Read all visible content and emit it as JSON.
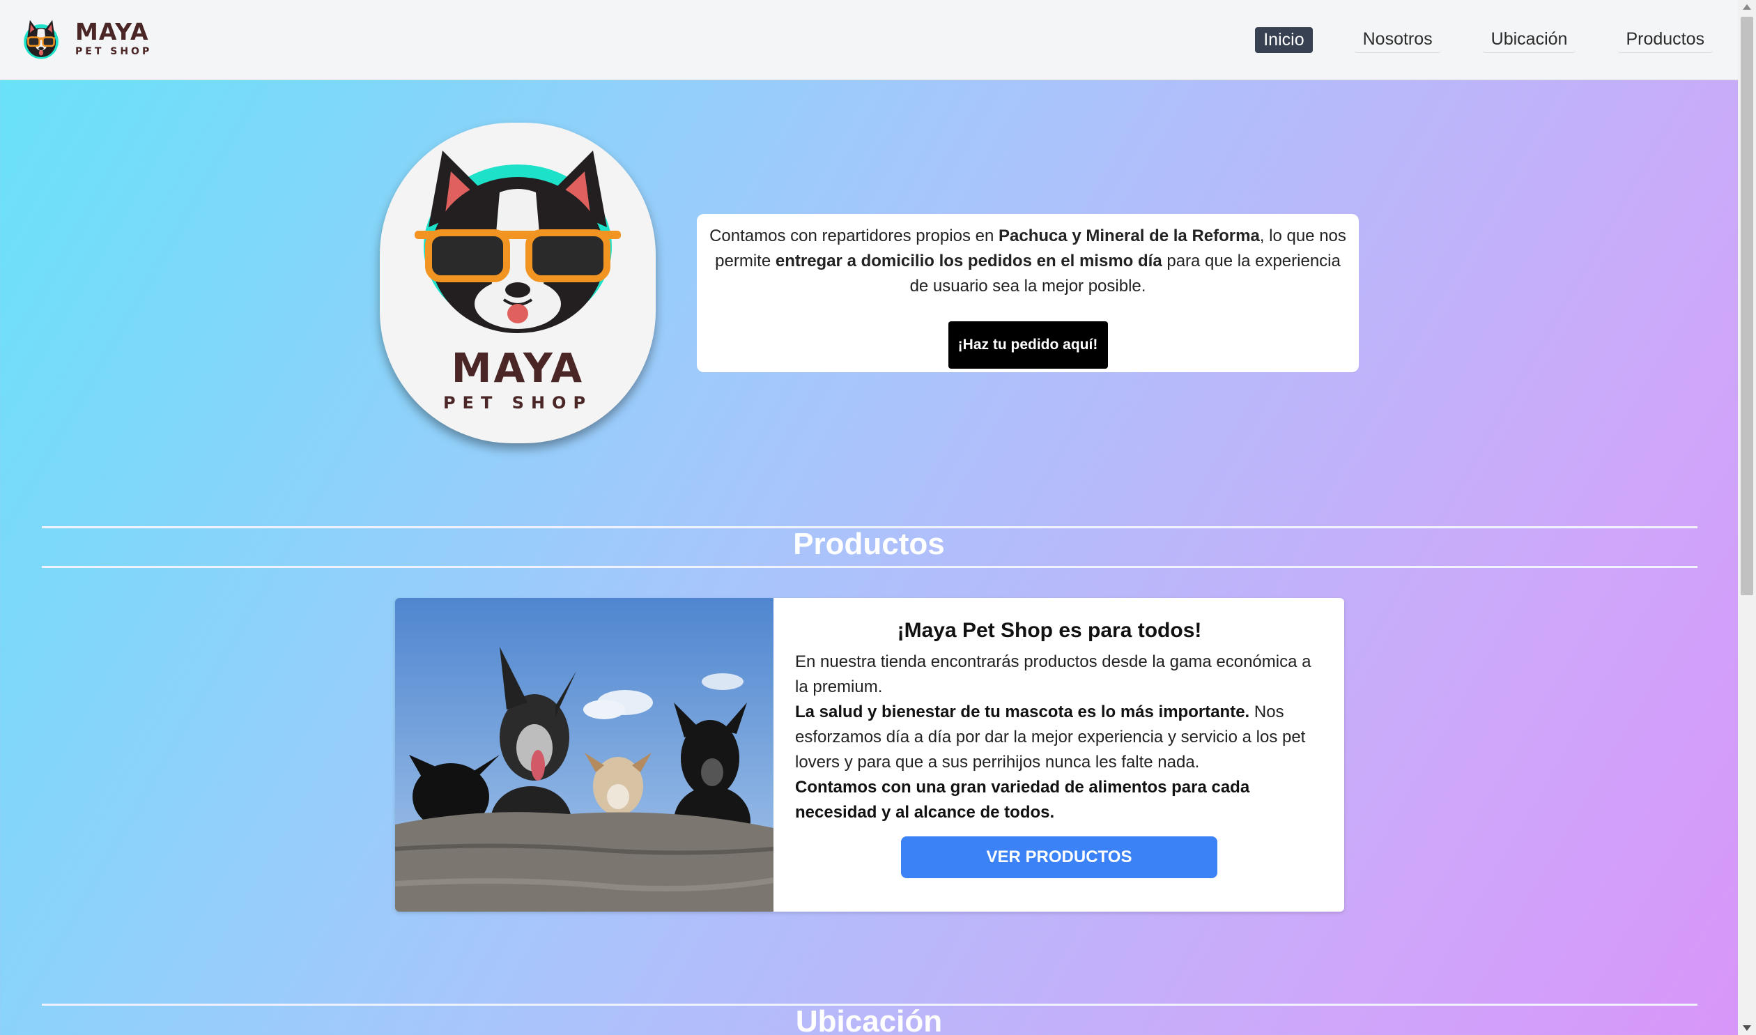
{
  "navbar": {
    "brand_title": "MAYA",
    "brand_subtitle": "PET SHOP",
    "links": [
      "Inicio",
      "Nosotros",
      "Ubicación",
      "Productos"
    ],
    "active_link": "Inicio"
  },
  "hero": {
    "logo_title": "MAYA",
    "logo_subtitle": "PET SHOP",
    "delivery_text_1": "Contamos con repartidores propios en ",
    "delivery_bold_1": "Pachuca y Mineral de la Reforma",
    "delivery_text_2": ", lo que nos permite ",
    "delivery_bold_2": "entregar a domicilio los pedidos en el mismo día",
    "delivery_text_3": " para que la experiencia de usuario sea la mejor posible.",
    "order_button": "¡Haz tu pedido aquí!"
  },
  "products_section": {
    "title": "Productos",
    "card_title": "¡Maya Pet Shop es para todos!",
    "text_1": "En nuestra tienda encontrarás productos desde la gama económica a la premium.",
    "bold_1": "La salud y bienestar de tu mascota es lo más importante.",
    "text_2": " Nos esforzamos día a día por dar la mejor experiencia y servicio a los pet lovers y para que a sus perrihijos nunca les falte nada.",
    "bold_2": "Contamos con una gran variedad de alimentos para cada necesidad y al alcance de todos.",
    "button": "VER PRODUCTOS"
  },
  "location_section": {
    "title": "Ubicación"
  },
  "colors": {
    "gradient_start": "#66e3f7",
    "gradient_end": "#d895f9",
    "active_nav": "#374151",
    "primary_button": "#3b82f6",
    "brand_text": "#4a2626",
    "logo_accent": "#1de2c9"
  }
}
